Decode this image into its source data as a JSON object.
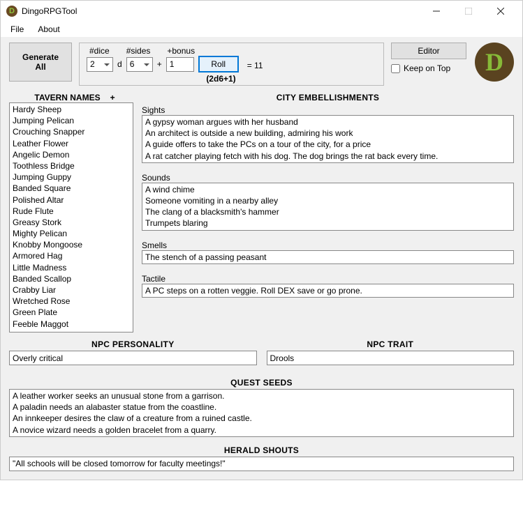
{
  "window": {
    "title": "DingoRPGTool"
  },
  "menu": {
    "file": "File",
    "about": "About"
  },
  "buttons": {
    "generateAll": "Generate\nAll",
    "roll": "Roll",
    "editor": "Editor"
  },
  "dice": {
    "lbl_numdice": "#dice",
    "lbl_numsides": "#sides",
    "lbl_bonus": "+bonus",
    "numdice": "2",
    "d": "d",
    "numsides": "6",
    "plus": "+",
    "bonus": "1",
    "result_prefix": "= ",
    "result": "11",
    "formula": "(2d6+1)"
  },
  "keepOnTop": "Keep on Top",
  "sections": {
    "tavern_header": "TAVERN NAMES",
    "tavern_plus": "+",
    "city_header": "CITY EMBELLISHMENTS",
    "sights_lbl": "Sights",
    "sounds_lbl": "Sounds",
    "smells_lbl": "Smells",
    "tactile_lbl": "Tactile",
    "npc_personality_header": "NPC PERSONALITY",
    "npc_trait_header": "NPC TRAIT",
    "quest_header": "QUEST SEEDS",
    "herald_header": "HERALD SHOUTS"
  },
  "tavern_names": [
    "Hardy Sheep",
    "Jumping Pelican",
    "Crouching Snapper",
    "Leather Flower",
    "Angelic Demon",
    "Toothless Bridge",
    "Jumping Guppy",
    "Banded Square",
    "Polished Altar",
    "Rude Flute",
    "Greasy Stork",
    "Mighty Pelican",
    "Knobby Mongoose",
    "Armored Hag",
    "Little Madness",
    "Banded Scallop",
    "Crabby Liar",
    "Wretched Rose",
    "Green Plate",
    "Feeble Maggot"
  ],
  "sights": [
    "A gypsy woman argues with her husband",
    "An architect is outside a new building, admiring his work",
    "A guide offers to take the PCs on a tour of the city, for a price",
    "A rat catcher playing fetch with his dog. The dog brings the rat back every time."
  ],
  "sounds": [
    "A wind chime",
    "Someone vomiting in a nearby alley",
    "The clang of a blacksmith's hammer",
    "Trumpets blaring"
  ],
  "smells": "The stench of a passing peasant",
  "tactile": "A PC steps on a rotten veggie. Roll DEX save or go prone.",
  "npc_personality": "Overly critical",
  "npc_trait": "Drools",
  "quest_seeds": [
    "A leather worker seeks an unusual stone from a garrison.",
    "A paladin needs an alabaster statue from the coastline.",
    "An innkeeper desires the claw of a creature from a ruined castle.",
    "A novice wizard needs a golden bracelet from a quarry."
  ],
  "herald": "\"All schools will be closed tomorrow for faculty meetings!\""
}
